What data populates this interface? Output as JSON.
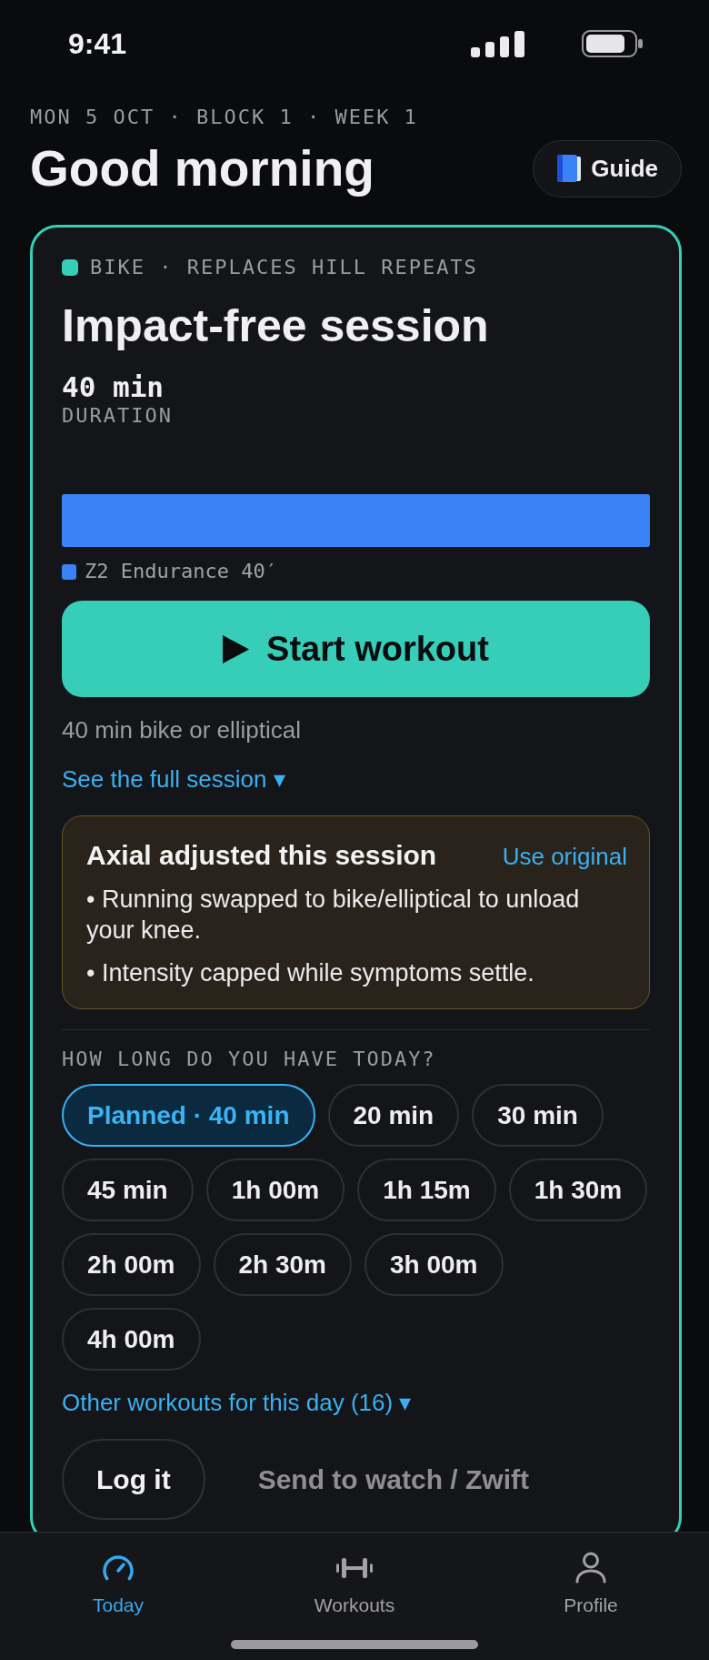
{
  "status_bar": {
    "time": "9:41"
  },
  "header": {
    "date_line": "MON 5 OCT · BLOCK 1 · WEEK 1",
    "greeting": "Good morning",
    "guide_button": "Guide"
  },
  "session_card": {
    "tag": "BIKE · REPLACES HILL REPEATS",
    "title": "Impact-free session",
    "stats": [
      {
        "value": "40 min",
        "label": "DURATION"
      }
    ],
    "zones": [
      {
        "label": "Z2 Endurance 40′",
        "color": "#3b82f6"
      }
    ],
    "start_button": "Start workout",
    "summary": "40 min bike or elliptical",
    "full_session_link": "See the full session ▾",
    "adjustment": {
      "title": "Axial adjusted this session",
      "action": "Use original",
      "notes": [
        "• Running swapped to bike/elliptical to unload your knee.",
        "• Intensity capped while symptoms settle."
      ]
    },
    "duration_prompt": "HOW LONG DO YOU HAVE TODAY?",
    "duration_options": [
      {
        "label": "Planned · 40 min",
        "selected": true
      },
      {
        "label": "20 min",
        "selected": false
      },
      {
        "label": "30 min",
        "selected": false
      },
      {
        "label": "45 min",
        "selected": false
      },
      {
        "label": "1h 00m",
        "selected": false
      },
      {
        "label": "1h 15m",
        "selected": false
      },
      {
        "label": "1h 30m",
        "selected": false
      },
      {
        "label": "2h 00m",
        "selected": false
      },
      {
        "label": "2h 30m",
        "selected": false
      },
      {
        "label": "3h 00m",
        "selected": false
      },
      {
        "label": "4h 00m",
        "selected": false
      }
    ],
    "other_workouts_link": "Other workouts for this day (16) ▾",
    "actions": [
      {
        "label": "Log it",
        "disabled": false
      },
      {
        "label": "Send to watch / Zwift",
        "disabled": true
      }
    ]
  },
  "bottom_nav": [
    {
      "label": "Today",
      "selected": true
    },
    {
      "label": "Workouts",
      "selected": false
    },
    {
      "label": "Profile",
      "selected": false
    }
  ]
}
